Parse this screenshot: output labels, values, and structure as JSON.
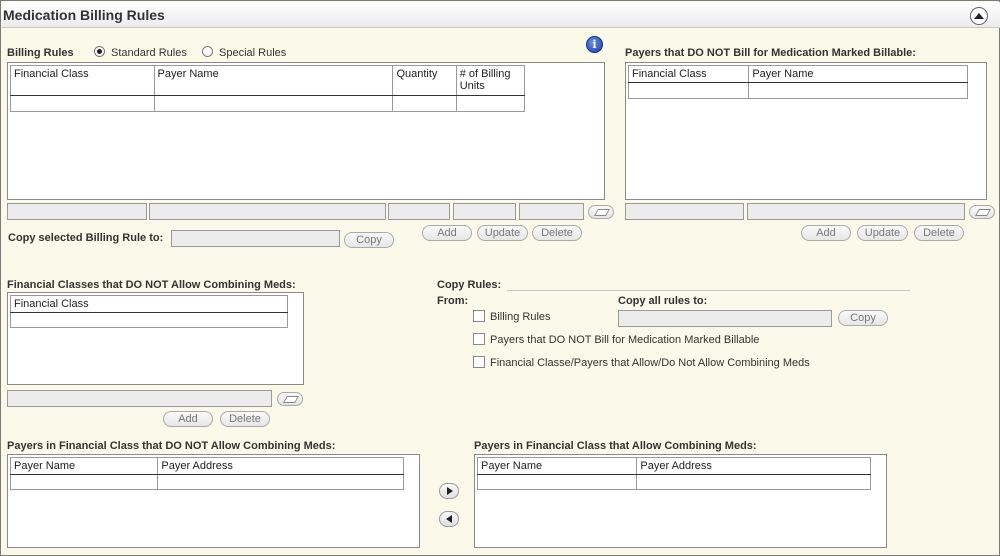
{
  "title": "Medication Billing Rules",
  "billing_rules": {
    "label": "Billing Rules",
    "radio_standard": "Standard Rules",
    "radio_special": "Special Rules",
    "columns": [
      "Financial Class",
      "Payer Name",
      "Quantity",
      "# of Billing Units"
    ],
    "copy_label": "Copy selected Billing Rule to:",
    "copy_button": "Copy",
    "add": "Add",
    "update": "Update",
    "delete": "Delete"
  },
  "payers_not_bill": {
    "label": "Payers that DO NOT Bill for Medication Marked Billable:",
    "columns": [
      "Financial Class",
      "Payer Name"
    ],
    "add": "Add",
    "update": "Update",
    "delete": "Delete"
  },
  "fin_classes": {
    "label": "Financial Classes that DO NOT Allow Combining Meds:",
    "columns": [
      "Financial Class"
    ],
    "add": "Add",
    "delete": "Delete"
  },
  "copy_rules": {
    "label": "Copy Rules:",
    "from": "From:",
    "copy_all": "Copy all rules to:",
    "copy_button": "Copy",
    "options": [
      "Billing Rules",
      "Payers that DO NOT Bill for Medication Marked Billable",
      "Financial Classe/Payers that Allow/Do Not Allow Combining Meds"
    ]
  },
  "payers_not_allow": {
    "label": "Payers in Financial Class that DO NOT Allow Combining Meds:",
    "columns": [
      "Payer Name",
      "Payer Address"
    ]
  },
  "payers_allow": {
    "label": "Payers in Financial Class that Allow Combining Meds:",
    "columns": [
      "Payer Name",
      "Payer Address"
    ]
  }
}
